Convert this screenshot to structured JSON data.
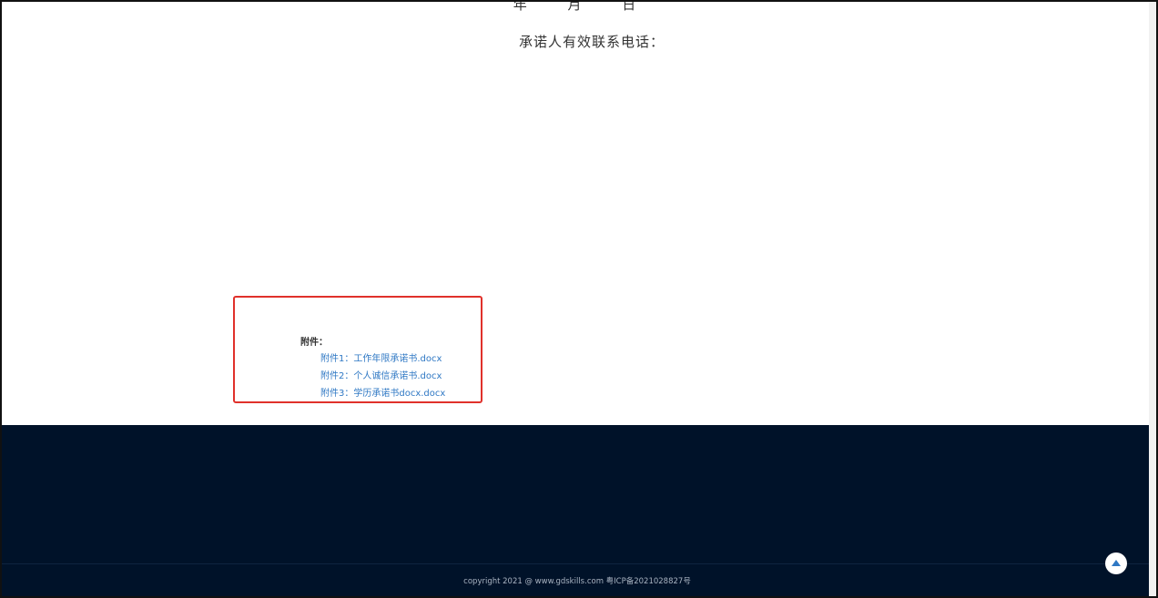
{
  "document": {
    "date_parts": [
      "年",
      "月",
      "日"
    ],
    "contact_label": "承诺人有效联系电话："
  },
  "attachments": {
    "title": "附件：",
    "items": [
      "附件1：工作年限承诺书.docx",
      "附件2：个人诚信承诺书.docx",
      "附件3：学历承诺书docx.docx"
    ]
  },
  "footer": {
    "copyright": "copyright 2021 @ www.gdskills.com 粤ICP备2021028827号"
  },
  "back_to_top": {
    "icon": "arrow-up-icon"
  },
  "colors": {
    "highlight_border": "#e0312b",
    "link": "#2f78c4",
    "footer_bg": "#001229"
  }
}
